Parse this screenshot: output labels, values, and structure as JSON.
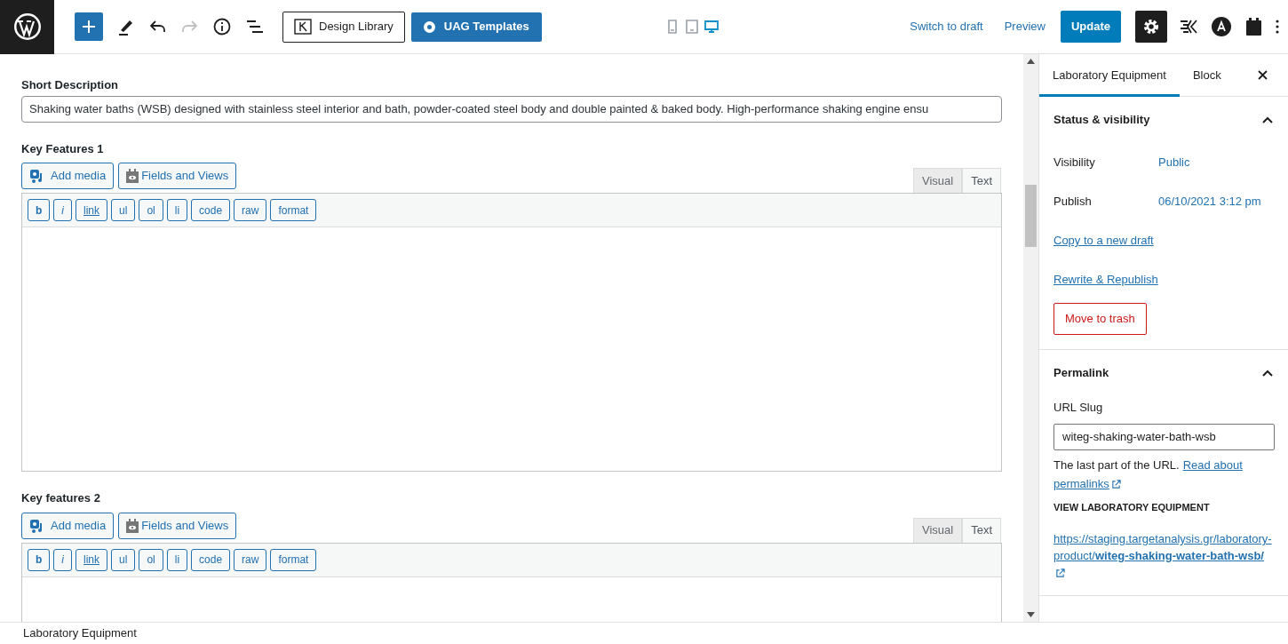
{
  "toolbar": {
    "design_library": "Design Library",
    "uag_templates": "UAG Templates",
    "preview_devices": [
      {
        "kind": "mobile",
        "selected": false
      },
      {
        "kind": "tablet",
        "selected": false
      },
      {
        "kind": "desktop",
        "selected": true
      }
    ],
    "switch_to_draft": "Switch to draft",
    "preview": "Preview",
    "update": "Update",
    "settings_active": true
  },
  "short_description": {
    "label": "Short Description",
    "value": "Shaking water baths (WSB) designed with stainless steel interior and bath, powder-coated steel body and double painted & baked body. High-performance shaking engine ensu"
  },
  "editors": [
    {
      "label": "Key Features 1",
      "buttons": [
        "Add media",
        "Fields and Views"
      ],
      "tabs": [
        {
          "label": "Visual",
          "selected": false
        },
        {
          "label": "Text",
          "selected": true
        }
      ],
      "quicktags": [
        "b",
        "i",
        "link",
        "ul",
        "ol",
        "li",
        "code",
        "raw",
        "format"
      ]
    },
    {
      "label": "Key features 2",
      "buttons": [
        "Add media",
        "Fields and Views"
      ],
      "tabs": [
        {
          "label": "Visual",
          "selected": false
        },
        {
          "label": "Text",
          "selected": true
        }
      ],
      "quicktags": [
        "b",
        "i",
        "link",
        "ul",
        "ol",
        "li",
        "code",
        "raw",
        "format"
      ]
    }
  ],
  "sidebar": {
    "tabs": [
      {
        "label": "Laboratory Equipment",
        "selected": true
      },
      {
        "label": "Block",
        "selected": false
      }
    ],
    "status": {
      "title": "Status & visibility",
      "expanded": true,
      "rows": [
        {
          "label": "Visibility",
          "value": "Public"
        },
        {
          "label": "Publish",
          "value": "06/10/2021 3:12 pm"
        }
      ],
      "links": [
        "Copy to a new draft",
        "Rewrite & Republish"
      ],
      "trash": "Move to trash"
    },
    "permalink": {
      "title": "Permalink",
      "expanded": true,
      "slug_label": "URL Slug",
      "slug": "witeg-shaking-water-bath-wsb",
      "help": "The last part of the URL.",
      "help_link_lines": [
        "Read about",
        "permalinks"
      ],
      "view_heading": "VIEW LABORATORY EQUIPMENT",
      "url_start": "https://staging.targetanalysis.gr/laboratory-product/",
      "url_end": "witeg-shaking-water-bath-wsb/"
    }
  },
  "breadcrumb": "Laboratory Equipment"
}
